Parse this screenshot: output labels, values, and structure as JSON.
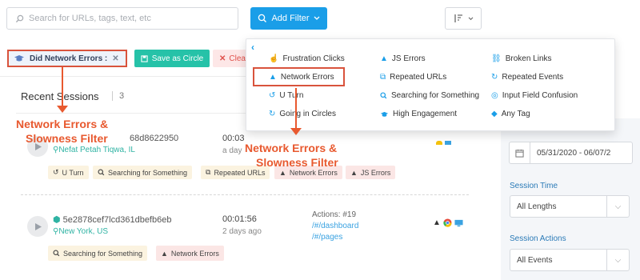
{
  "search": {
    "placeholder": "Search for URLs, tags, text, etc"
  },
  "toolbar": {
    "add_filter_label": "Add Filter"
  },
  "filter_chip": {
    "label": "Did Network Errors :"
  },
  "actions": {
    "save_circle": "Save as Circle",
    "clear": "Clea"
  },
  "sessions": {
    "title": "Recent Sessions",
    "count": "3",
    "rows": [
      {
        "id": "68d8622950",
        "location": "Nefat Petah Tiqwa, IL",
        "duration": "00:03",
        "ago": "a day",
        "tags": [
          "U Turn",
          "Searching for Something",
          "Repeated URLs",
          "Network Errors",
          "JS Errors"
        ]
      },
      {
        "id": "5e2878cef7lcd361dbefb6eb",
        "location": "New York, US",
        "duration": "00:01:56",
        "ago": "2 days ago",
        "actions_label": "Actions: #19",
        "action_links": [
          "/#/dashboard",
          "/#/pages"
        ],
        "tags": [
          "Searching for Something",
          "Network Errors"
        ]
      }
    ]
  },
  "dropdown": {
    "col1": [
      "Frustration Clicks",
      "Network Errors",
      "U Turn",
      "Going in Circles"
    ],
    "col2": [
      "JS Errors",
      "Repeated URLs",
      "Searching for Something",
      "High Engagement"
    ],
    "col3": [
      "Broken Links",
      "Repeated Events",
      "Input Field Confusion",
      "Any Tag"
    ]
  },
  "right_panel": {
    "date_range": "05/31/2020 - 06/07/2",
    "session_time_label": "Session Time",
    "session_time_value": "All Lengths",
    "session_actions_label": "Session Actions",
    "session_actions_value": "All Events"
  },
  "annotations": {
    "left_line1": "Network Errors &",
    "left_line2": "Slowness Filter",
    "right_line1": "Network Errors &",
    "right_line2": "Slowness Filter"
  },
  "colors": {
    "accent": "#1a9ee8",
    "teal": "#26c2a8",
    "annotation": "#e8592f"
  }
}
